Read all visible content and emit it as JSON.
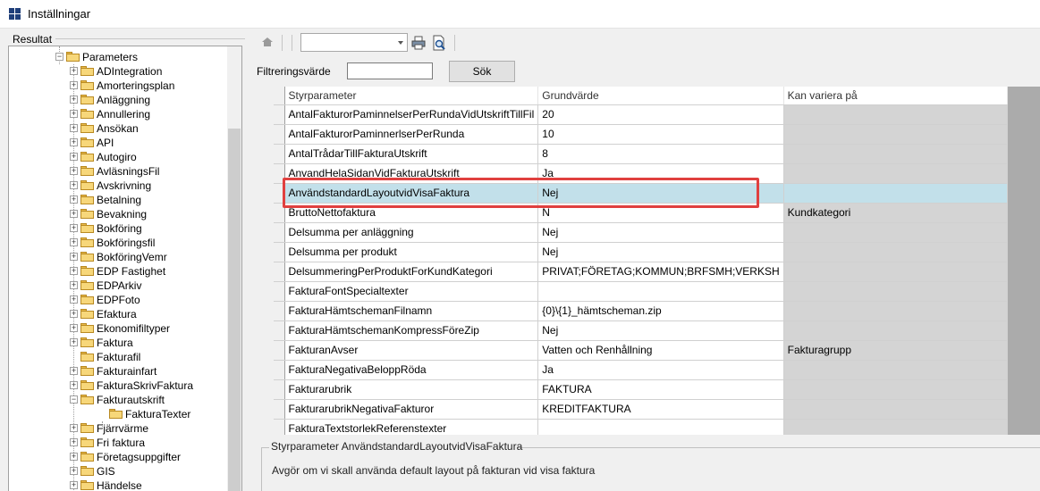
{
  "window": {
    "title": "Inställningar"
  },
  "left_panel": {
    "caption": "Resultat"
  },
  "tree": {
    "root": "Parameters",
    "items": [
      {
        "label": "ADIntegration",
        "expandable": true
      },
      {
        "label": "Amorteringsplan",
        "expandable": true
      },
      {
        "label": "Anläggning",
        "expandable": true
      },
      {
        "label": "Annullering",
        "expandable": true
      },
      {
        "label": "Ansökan",
        "expandable": true
      },
      {
        "label": "API",
        "expandable": true
      },
      {
        "label": "Autogiro",
        "expandable": true
      },
      {
        "label": "AvläsningsFil",
        "expandable": true
      },
      {
        "label": "Avskrivning",
        "expandable": true
      },
      {
        "label": "Betalning",
        "expandable": true
      },
      {
        "label": "Bevakning",
        "expandable": true
      },
      {
        "label": "Bokföring",
        "expandable": true
      },
      {
        "label": "Bokföringsfil",
        "expandable": true
      },
      {
        "label": "BokföringVemr",
        "expandable": true
      },
      {
        "label": "EDP Fastighet",
        "expandable": true
      },
      {
        "label": "EDPArkiv",
        "expandable": true
      },
      {
        "label": "EDPFoto",
        "expandable": true
      },
      {
        "label": "Efaktura",
        "expandable": true
      },
      {
        "label": "Ekonomifiltyper",
        "expandable": true
      },
      {
        "label": "Faktura",
        "expandable": true
      },
      {
        "label": "Fakturafil",
        "expandable": false
      },
      {
        "label": "Fakturainfart",
        "expandable": true
      },
      {
        "label": "FakturaSkrivFaktura",
        "expandable": true
      },
      {
        "label": "Fakturautskrift",
        "expandable": true,
        "expanded": true
      },
      {
        "label": "FakturaTexter",
        "expandable": false,
        "child": true
      },
      {
        "label": "Fjärrvärme",
        "expandable": true
      },
      {
        "label": "Fri faktura",
        "expandable": true
      },
      {
        "label": "Företagsuppgifter",
        "expandable": true
      },
      {
        "label": "GIS",
        "expandable": true
      },
      {
        "label": "Händelse",
        "expandable": true
      }
    ]
  },
  "toolbar": {
    "home_icon": "home-icon",
    "combo_value": "",
    "print_icon": "printer-icon",
    "preview_icon": "print-preview-icon"
  },
  "filter": {
    "label": "Filtreringsvärde",
    "value": "",
    "search_label": "Sök"
  },
  "grid": {
    "columns": [
      "Styrparameter",
      "Grundvärde",
      "Kan variera på"
    ],
    "rows": [
      [
        "AntalFakturorPaminnelserPerRundaVidUtskriftTillFil",
        "20",
        ""
      ],
      [
        "AntalFakturorPaminnerlserPerRunda",
        "10",
        ""
      ],
      [
        "AntalTrådarTillFakturaUtskrift",
        "8",
        ""
      ],
      [
        "AnvandHelaSidanVidFakturaUtskrift",
        "Ja",
        ""
      ],
      [
        "AnvändstandardLayoutvidVisaFaktura",
        "Nej",
        ""
      ],
      [
        "BruttoNettofaktura",
        "N",
        "Kundkategori"
      ],
      [
        "Delsumma per anläggning",
        "Nej",
        ""
      ],
      [
        "Delsumma per produkt",
        "Nej",
        ""
      ],
      [
        "DelsummeringPerProduktForKundKategori",
        "PRIVAT;FÖRETAG;KOMMUN;BRFSMH;VERKSH",
        ""
      ],
      [
        "FakturaFontSpecialtexter",
        "",
        ""
      ],
      [
        "FakturaHämtschemanFilnamn",
        "{0}\\{1}_hämtscheman.zip",
        ""
      ],
      [
        "FakturaHämtschemanKompressFöreZip",
        "Nej",
        ""
      ],
      [
        "FakturanAvser",
        "Vatten och Renhållning",
        "Fakturagrupp"
      ],
      [
        "FakturaNegativaBeloppRöda",
        "Ja",
        ""
      ],
      [
        "Fakturarubrik",
        "FAKTURA",
        ""
      ],
      [
        "FakturarubrikNegativaFakturor",
        "KREDITFAKTURA",
        ""
      ],
      [
        "FakturaTextstorlekReferenstexter",
        "",
        ""
      ]
    ],
    "selected_row": 4
  },
  "description": {
    "title": "Styrparameter AnvändstandardLayoutvidVisaFaktura",
    "text": "Avgör om vi skall använda default layout på fakturan vid visa faktura"
  },
  "colors": {
    "selection": "#c2e0ea",
    "highlight_box": "#e0403f",
    "readonly_cell": "#d4d4d4"
  }
}
